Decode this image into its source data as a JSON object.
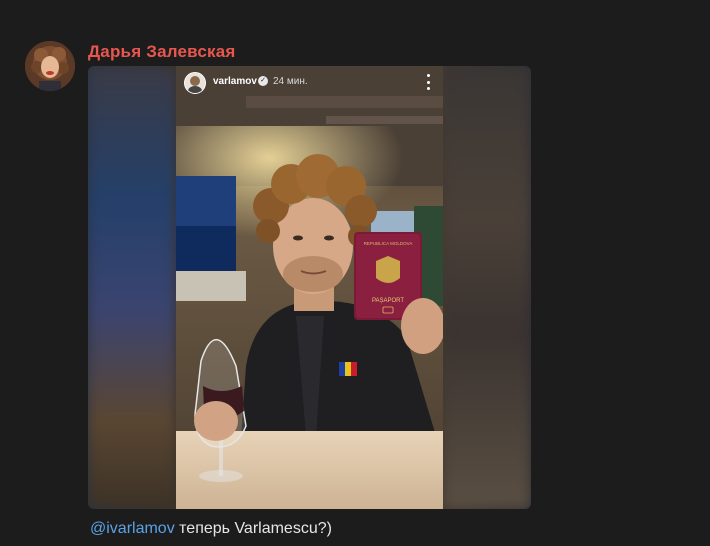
{
  "message": {
    "sender_name": "Дарья Залевская",
    "caption_mention": "@ivarlamov",
    "caption_text": " теперь Varlamescu?)"
  },
  "story": {
    "username": "varlamov",
    "time": "24 мин.",
    "verified_icon": "verified-icon",
    "more_icon": "more-vertical-icon"
  },
  "passport": {
    "country_line": "REPUBLICA MOLDOVA",
    "label": "PAȘAPORT"
  },
  "colors": {
    "sender_name": "#e8574f",
    "mention": "#5aa2e6",
    "background": "#1c1c1c"
  }
}
